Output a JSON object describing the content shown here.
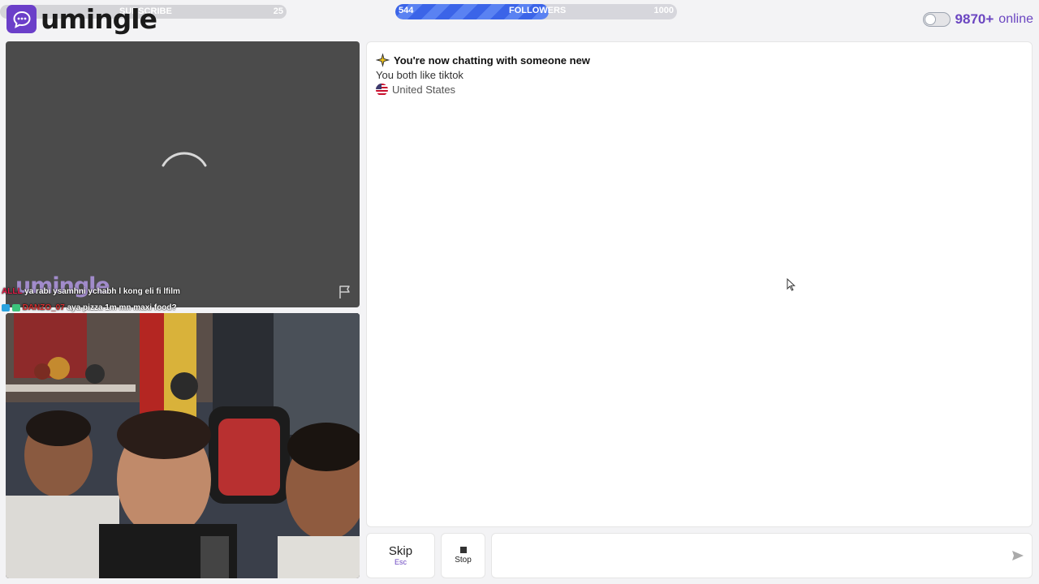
{
  "header": {
    "logo_text": "umingle",
    "subscribe_bar": {
      "label": "SUBSCRIBE",
      "current": "0",
      "goal": "25",
      "progress": 0
    },
    "followers_bar": {
      "label": "FOLLOWERS",
      "current": "544",
      "goal": "1000",
      "progress": 0.544
    },
    "online": {
      "count": "9870+",
      "label": "online",
      "toggle_on": false
    }
  },
  "video": {
    "top_state": "loading",
    "watermark": "umingle",
    "overlay_chat": [
      {
        "user": "ALLL",
        "text": "ya rabi ysamhni ychabh l kong eli fi lfilm"
      },
      {
        "user": "DANZO_07",
        "text": "aya pizza 1m mn maxi food?"
      }
    ]
  },
  "chat": {
    "messages": [
      {
        "icon": "sparkle-icon",
        "text": "You're now chatting with someone new"
      },
      {
        "text": "You both like tiktok"
      },
      {
        "icon": "us-flag-icon",
        "text": "United States"
      }
    ]
  },
  "controls": {
    "skip_label": "Skip",
    "skip_key": "Esc",
    "stop_label": "Stop",
    "message_placeholder": ""
  },
  "colors": {
    "brand": "#6b3fc9",
    "online": "#6b46c1",
    "followers_fill": "#3b64e8"
  }
}
